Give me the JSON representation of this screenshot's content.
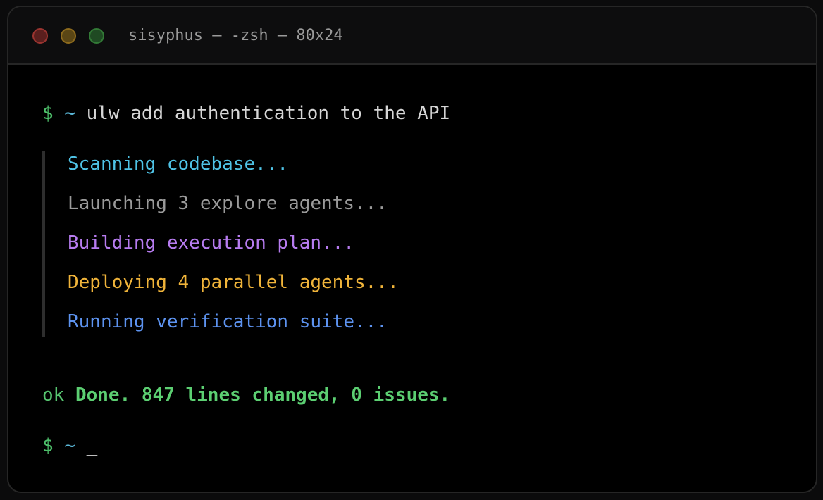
{
  "window": {
    "title": "sisyphus — -zsh — 80x24",
    "controls": [
      "close",
      "minimize",
      "zoom"
    ]
  },
  "terminal": {
    "prompt": {
      "dollar": "$",
      "tilde": "~"
    },
    "command": "ulw add authentication to the API",
    "log_lines": [
      {
        "text": "Scanning codebase...",
        "color": "#4fc3e6"
      },
      {
        "text": "Launching 3 explore agents...",
        "color": "#9a9a9a"
      },
      {
        "text": "Building execution plan...",
        "color": "#b77cf0"
      },
      {
        "text": "Deploying 4 parallel agents...",
        "color": "#f0b43a"
      },
      {
        "text": "Running verification suite...",
        "color": "#5d93f0"
      }
    ],
    "result": {
      "prefix": "ok",
      "message": "Done. 847 lines changed, 0 issues."
    },
    "cursor": "_"
  },
  "colors": {
    "prompt_green": "#4ec06b",
    "prompt_blue": "#5bb8d8",
    "background": "#000000"
  }
}
